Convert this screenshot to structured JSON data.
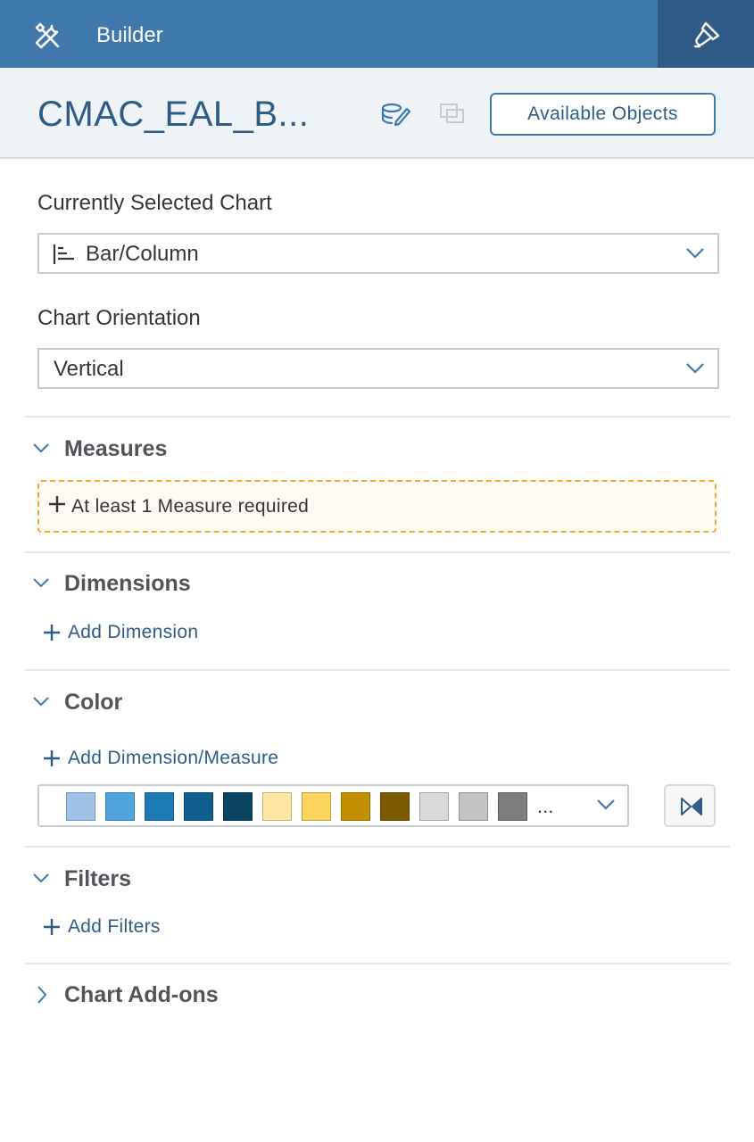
{
  "topbar": {
    "title": "Builder",
    "tools_icon": "tools-icon",
    "designer_icon": "paintbrush-icon"
  },
  "header": {
    "widget_name": "CMAC_EAL_B...",
    "edit_icon": "edit-icon",
    "duplicate_icon": "duplicate-icon",
    "available_objects_label": "Available Objects"
  },
  "chart": {
    "selected_label": "Currently Selected Chart",
    "selected_value": "Bar/Column",
    "selected_icon": "bar-chart-icon",
    "orientation_label": "Chart Orientation",
    "orientation_value": "Vertical"
  },
  "sections": {
    "measures": {
      "title": "Measures",
      "placeholder": "At least 1 Measure required"
    },
    "dimensions": {
      "title": "Dimensions",
      "add_label": "Add Dimension"
    },
    "color": {
      "title": "Color",
      "add_label": "Add Dimension/Measure",
      "more": "..."
    },
    "filters": {
      "title": "Filters",
      "add_label": "Add Filters"
    },
    "addons": {
      "title": "Chart Add-ons"
    }
  },
  "palette_colors": [
    "#9fc3e6",
    "#4fa4dc",
    "#1c7bb5",
    "#0f5e8e",
    "#0b4564",
    "#ffe7a3",
    "#fcd55e",
    "#c39100",
    "#7c5b00",
    "#d9d9d9",
    "#c3c3c3",
    "#7d7d7d"
  ],
  "colors": {
    "topbar": "#3f78ab",
    "topbar_active": "#2f5c87",
    "accent_text": "#2f5c87",
    "warning_border": "#f0ab2d"
  }
}
